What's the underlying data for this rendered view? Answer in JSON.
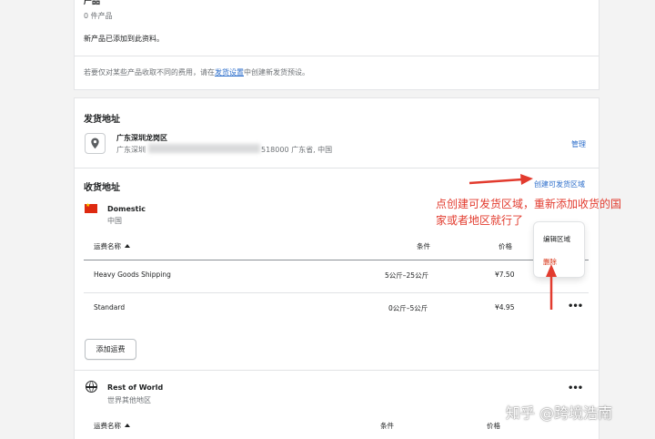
{
  "products_section": {
    "title_partial": "产品",
    "count": "0 件产品",
    "note": "新产品已添加到此资料。"
  },
  "fee_notice": {
    "text_before": "若要仅对某些产品收取不同的费用，请在",
    "link": "发货设置",
    "text_after": "中创建新发货预设。"
  },
  "ship_from": {
    "heading": "发货地址",
    "location_name": "广东深圳龙岗区",
    "address_start": "广东深圳",
    "address_end": "518000 广东省, 中国",
    "manage_link": "管理"
  },
  "ship_to": {
    "heading": "收货地址",
    "create_zone_link": "创建可发货区域"
  },
  "zone_domestic": {
    "name": "Domestic",
    "country": "中国",
    "columns": {
      "rate_name": "运费名称",
      "condition": "条件",
      "price": "价格"
    },
    "rates": [
      {
        "name": "Heavy Goods Shipping",
        "condition": "5公斤–25公斤",
        "price": "¥7.50"
      },
      {
        "name": "Standard",
        "condition": "0公斤–5公斤",
        "price": "¥4.95"
      }
    ],
    "add_rate_button": "添加运费"
  },
  "popover_menu": {
    "edit_zone": "编辑区域",
    "delete": "删除"
  },
  "zone_rest": {
    "name": "Rest of World",
    "subtitle": "世界其他地区",
    "columns": {
      "rate_name": "运费名称",
      "condition": "条件",
      "price": "价格"
    }
  },
  "annotation": {
    "line1": "点创建可发货区域，重新添加收货的国",
    "line2": "家或者地区就行了"
  },
  "watermark": "知乎 @跨境浩南",
  "more_actions_glyph": "•••",
  "colors": {
    "link": "#2c6ecb",
    "annotation_red": "#e23b2e",
    "danger": "#d72c0d"
  }
}
